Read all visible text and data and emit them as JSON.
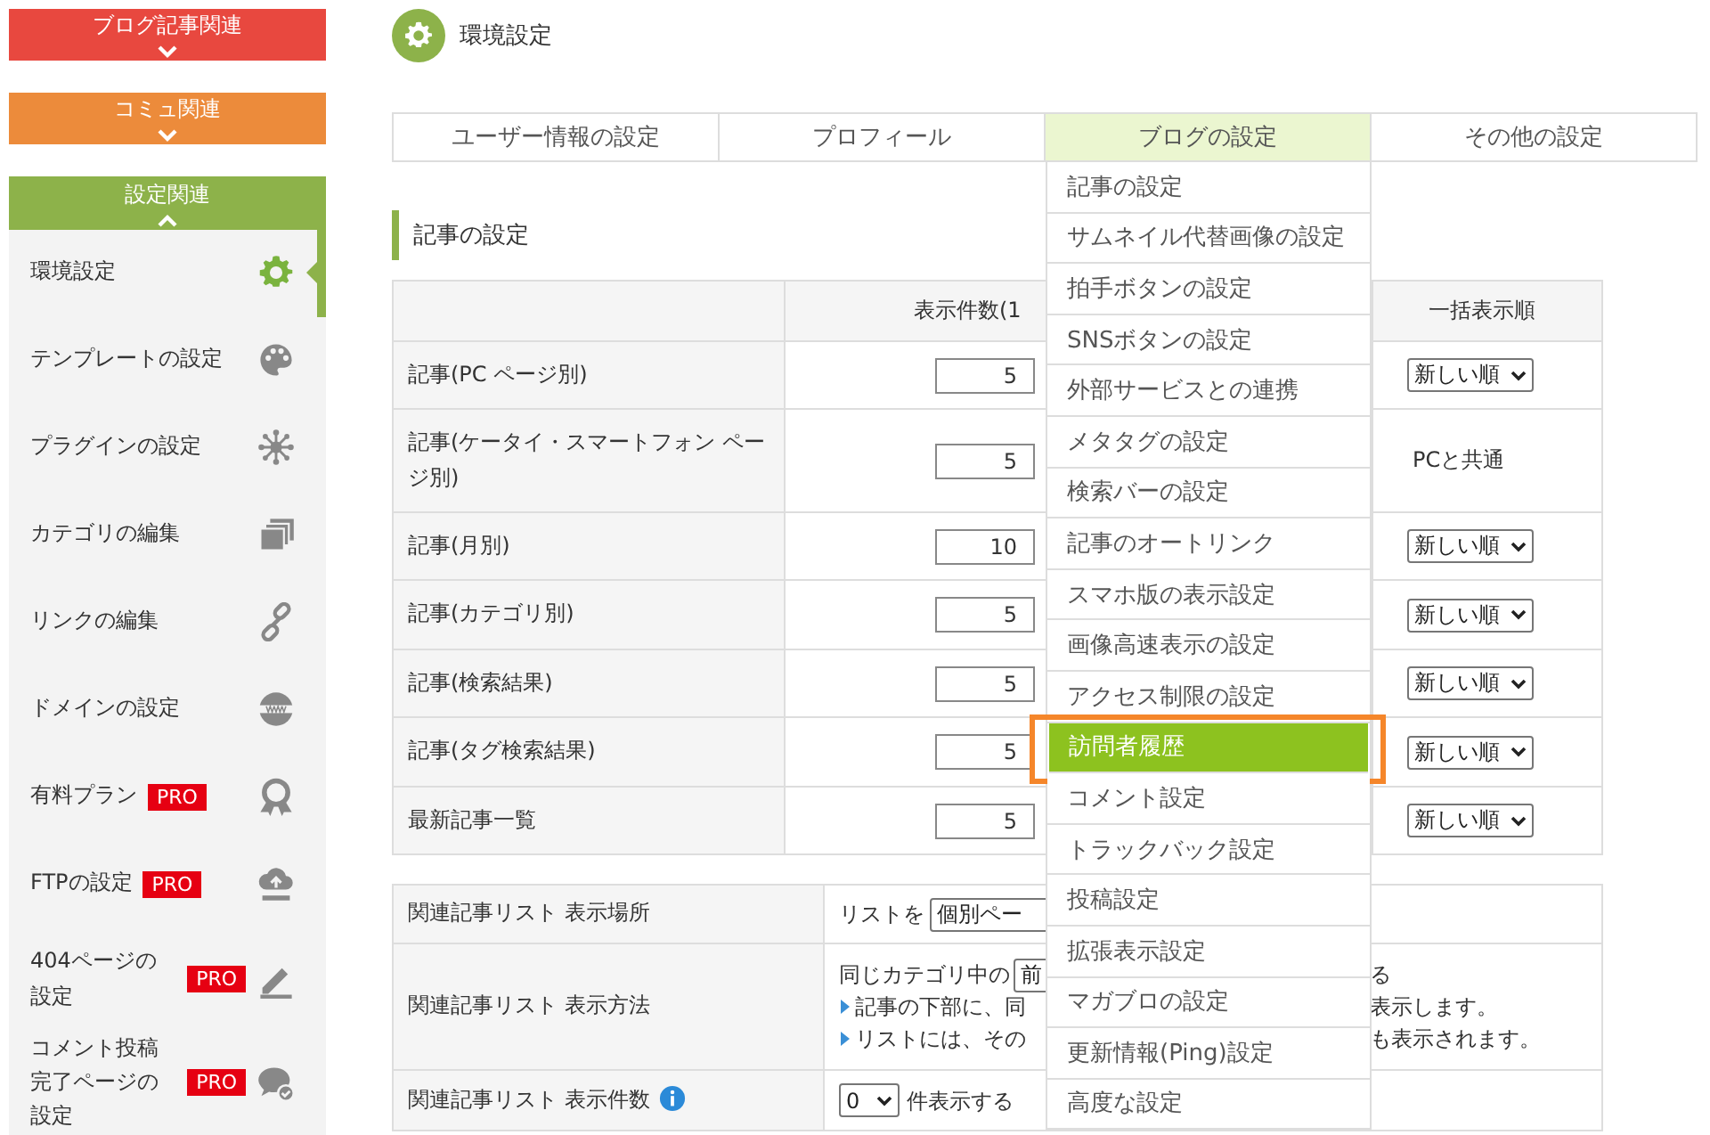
{
  "sidebar": {
    "sections": [
      {
        "label": "ブログ記事関連",
        "color": "#e8483f",
        "expanded": false
      },
      {
        "label": "コミュ関連",
        "color": "#ec8b3b",
        "expanded": false
      },
      {
        "label": "設定関連",
        "color": "#8db24a",
        "expanded": true
      }
    ],
    "items": [
      {
        "label": "環境設定",
        "selected": true
      },
      {
        "label": "テンプレートの設定",
        "selected": false
      },
      {
        "label": "プラグインの設定",
        "selected": false
      },
      {
        "label": "カテゴリの編集",
        "selected": false
      },
      {
        "label": "リンクの編集",
        "selected": false
      },
      {
        "label": "ドメインの設定",
        "selected": false
      },
      {
        "label": "有料プラン",
        "badge": "PRO",
        "selected": false
      },
      {
        "label": "FTPの設定",
        "badge": "PRO",
        "selected": false
      },
      {
        "label": "404ページの設定",
        "badge": "PRO",
        "selected": false
      },
      {
        "label": "コメント投稿完了ページの設定",
        "badge": "PRO",
        "selected": false
      }
    ]
  },
  "header": {
    "title": "環境設定"
  },
  "tabs": [
    {
      "label": "ユーザー情報の設定",
      "selected": false
    },
    {
      "label": "プロフィール",
      "selected": false
    },
    {
      "label": "ブログの設定",
      "selected": true
    },
    {
      "label": "その他の設定",
      "selected": false
    }
  ],
  "menu": {
    "items": [
      {
        "label": "記事の設定",
        "selected": false,
        "annotated": false
      },
      {
        "label": "サムネイル代替画像の設定",
        "selected": false,
        "annotated": false
      },
      {
        "label": "拍手ボタンの設定",
        "selected": false,
        "annotated": false
      },
      {
        "label": "SNSボタンの設定",
        "selected": false,
        "annotated": false
      },
      {
        "label": "外部サービスとの連携",
        "selected": false,
        "annotated": false
      },
      {
        "label": "メタタグの設定",
        "selected": false,
        "annotated": false
      },
      {
        "label": "検索バーの設定",
        "selected": false,
        "annotated": false
      },
      {
        "label": "記事のオートリンク",
        "selected": false,
        "annotated": false
      },
      {
        "label": "スマホ版の表示設定",
        "selected": false,
        "annotated": false
      },
      {
        "label": "画像高速表示の設定",
        "selected": false,
        "annotated": false
      },
      {
        "label": "アクセス制限の設定",
        "selected": false,
        "annotated": false
      },
      {
        "label": "訪問者履歴",
        "selected": true,
        "annotated": true
      },
      {
        "label": "コメント設定",
        "selected": false,
        "annotated": false
      },
      {
        "label": "トラックバック設定",
        "selected": false,
        "annotated": false
      },
      {
        "label": "投稿設定",
        "selected": false,
        "annotated": false
      },
      {
        "label": "拡張表示設定",
        "selected": false,
        "annotated": false
      },
      {
        "label": "マガブロの設定",
        "selected": false,
        "annotated": false
      },
      {
        "label": "更新情報(Ping)設定",
        "selected": false,
        "annotated": false
      },
      {
        "label": "高度な設定",
        "selected": false,
        "annotated": false
      }
    ]
  },
  "section_title": "記事の設定",
  "article_table": {
    "columns": [
      "表示件数(1",
      "一括表示順"
    ],
    "rows": [
      {
        "label": "記事(PC ページ別)",
        "count": "5",
        "order": {
          "kind": "select",
          "value": "新しい順"
        }
      },
      {
        "label": "記事(ケータイ・スマートフォン ページ別)",
        "count": "5",
        "order": {
          "kind": "text",
          "value": "PCと共通"
        }
      },
      {
        "label": "記事(月別)",
        "count": "10",
        "order": {
          "kind": "select",
          "value": "新しい順"
        }
      },
      {
        "label": "記事(カテゴリ別)",
        "count": "5",
        "order": {
          "kind": "select",
          "value": "新しい順"
        }
      },
      {
        "label": "記事(検索結果)",
        "count": "5",
        "order": {
          "kind": "select",
          "value": "新しい順"
        }
      },
      {
        "label": "記事(タグ検索結果)",
        "count": "5",
        "order": {
          "kind": "select",
          "value": "新しい順"
        }
      },
      {
        "label": "最新記事一覧",
        "count": "5",
        "order": {
          "kind": "select",
          "value": "新しい順"
        }
      }
    ]
  },
  "related_table": {
    "rows": [
      {
        "kind": "place",
        "label": "関連記事リスト 表示場所",
        "prefix": "リストを",
        "select": "個別ペー"
      },
      {
        "kind": "method",
        "label": "関連記事リスト 表示方法",
        "lines": [
          {
            "bullet": false,
            "left": "同じカテゴリ中の",
            "select": "前",
            "right": "る"
          },
          {
            "bullet": true,
            "left": "記事の下部に、同",
            "right": "表示します。"
          },
          {
            "bullet": true,
            "left": "リストには、その",
            "right": "も表示されます。"
          }
        ]
      },
      {
        "kind": "count",
        "label": "関連記事リスト 表示件数",
        "info": true,
        "select": "0",
        "suffix": "件表示する"
      }
    ]
  }
}
